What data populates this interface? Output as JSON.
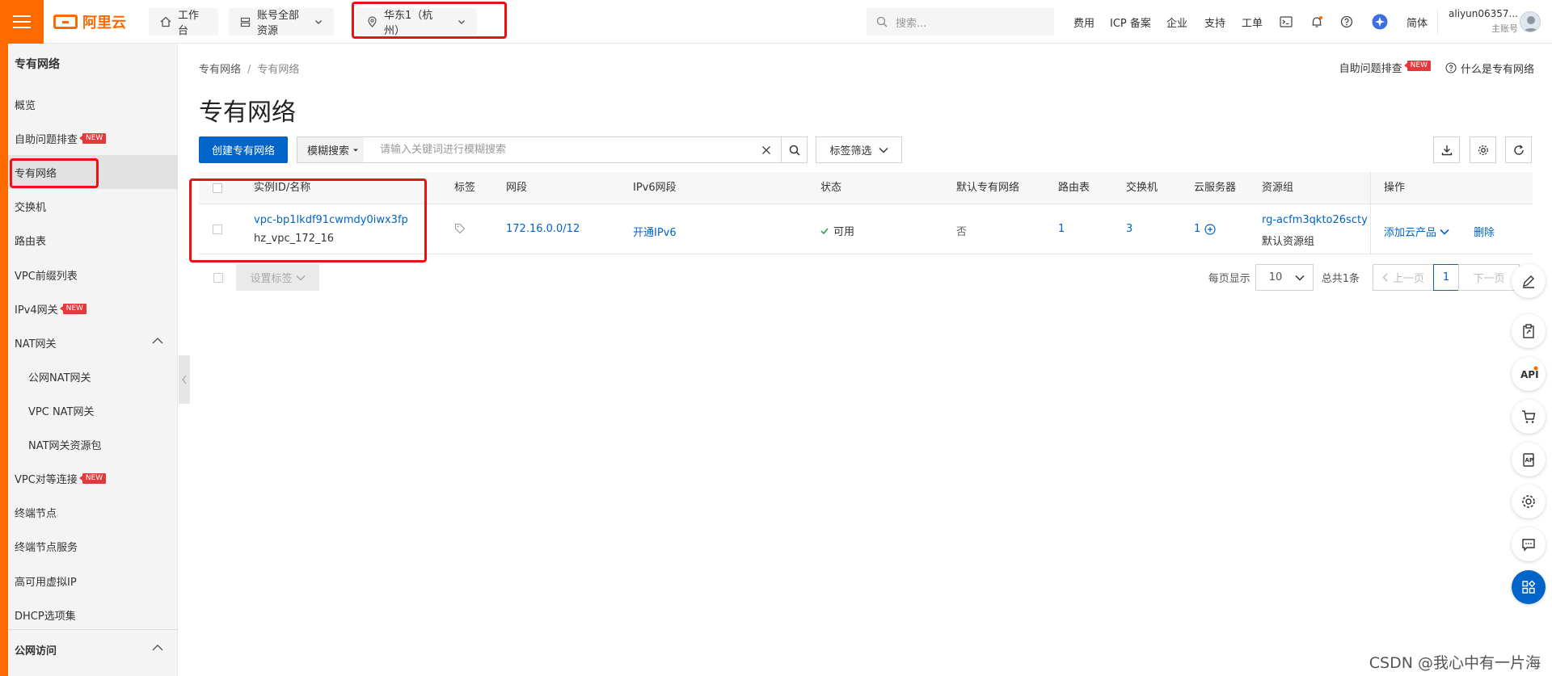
{
  "topbar": {
    "logo_text": "阿里云",
    "workbench": "工作台",
    "resources": "账号全部资源",
    "region": "华东1（杭州）",
    "search_placeholder": "搜索...",
    "nav": [
      "费用",
      "ICP 备案",
      "企业",
      "支持",
      "工单"
    ],
    "lang": "简体",
    "user_name": "aliyun06357...",
    "user_role": "主账号"
  },
  "sidebar": {
    "title": "专有网络",
    "items": [
      {
        "label": "概览"
      },
      {
        "label": "自助问题排查",
        "badge": "NEW"
      },
      {
        "label": "专有网络"
      },
      {
        "label": "交换机"
      },
      {
        "label": "路由表"
      },
      {
        "label": "VPC前缀列表"
      },
      {
        "label": "IPv4网关",
        "badge": "NEW"
      },
      {
        "label": "NAT网关"
      },
      {
        "label": "公网NAT网关"
      },
      {
        "label": "VPC NAT网关"
      },
      {
        "label": "NAT网关资源包"
      },
      {
        "label": "VPC对等连接",
        "badge": "NEW"
      },
      {
        "label": "终端节点"
      },
      {
        "label": "终端节点服务"
      },
      {
        "label": "高可用虚拟IP"
      },
      {
        "label": "DHCP选项集"
      },
      {
        "label": "公网访问"
      }
    ]
  },
  "main": {
    "breadcrumb": [
      "专有网络",
      "专有网络"
    ],
    "title": "专有网络",
    "help_troubleshoot": "自助问题排查",
    "help_badge": "NEW",
    "help_what": "什么是专有网络",
    "create_button": "创建专有网络",
    "fuzzy_search": "模糊搜索",
    "keyword_placeholder": "请输入关键词进行模糊搜索",
    "tag_filter": "标签筛选"
  },
  "table": {
    "columns": [
      "实例ID/名称",
      "标签",
      "网段",
      "IPv6网段",
      "状态",
      "默认专有网络",
      "路由表",
      "交换机",
      "云服务器",
      "资源组",
      "操作"
    ],
    "row": {
      "id": "vpc-bp1lkdf91cwmdy0iwx3fp",
      "name": "hz_vpc_172_16",
      "cidr": "172.16.0.0/12",
      "ipv6": "开通IPv6",
      "status": "可用",
      "default_vpc": "否",
      "route_tables": "1",
      "vswitches": "3",
      "ecs": "1",
      "resource_group_id": "rg-acfm3qkto26scty",
      "resource_group_name": "默认资源组",
      "op_add": "添加云产品",
      "op_delete": "删除"
    }
  },
  "footer": {
    "set_tag": "设置标签",
    "per_page_label": "每页显示",
    "per_page": "10",
    "total": "总共1条",
    "prev": "上一页",
    "page": "1",
    "next": "下一页"
  },
  "watermark": "CSDN @我心中有一片海",
  "colors": {
    "brand": "#ff6a00",
    "primary": "#0064c8",
    "highlight": "#e11111"
  }
}
